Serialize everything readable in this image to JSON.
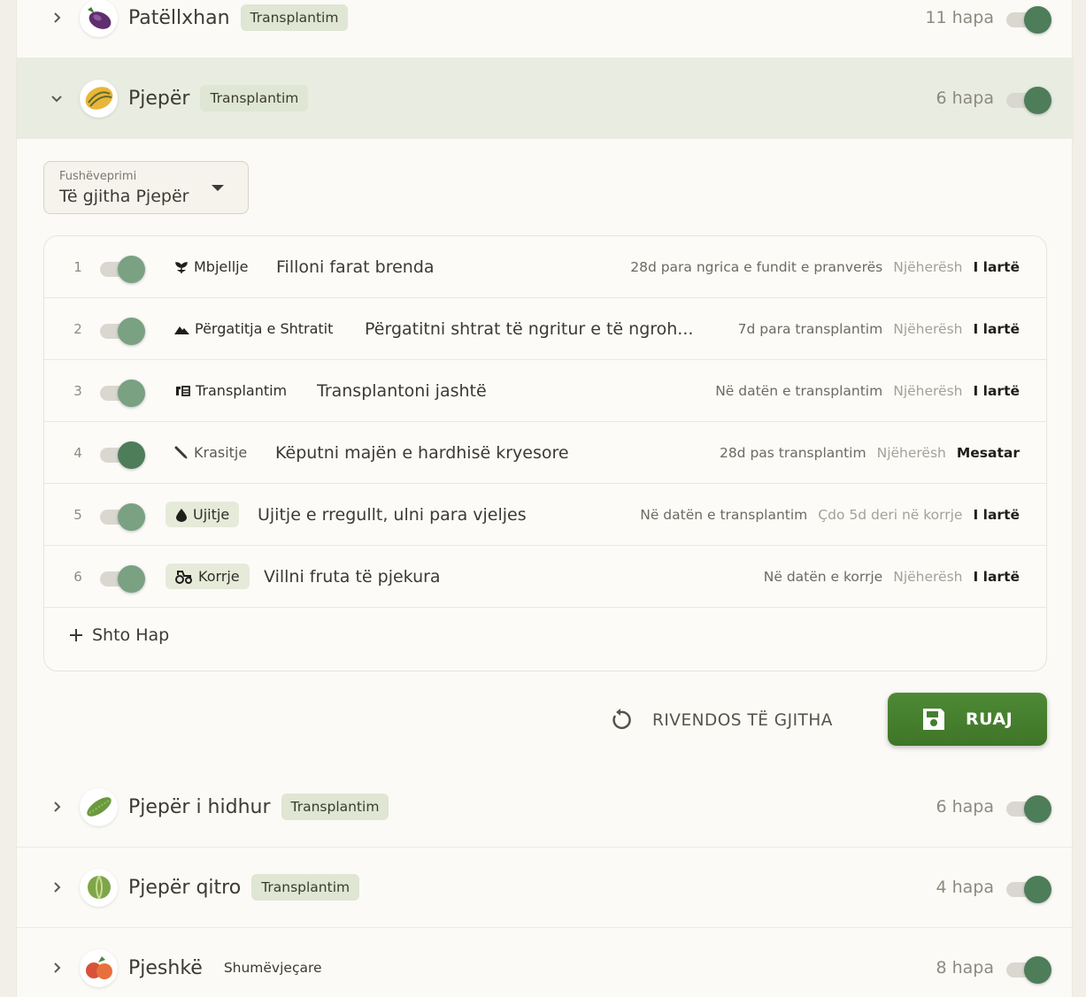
{
  "plants": [
    {
      "name": "Patëllxhan",
      "tag": "Transplantim",
      "steps": "11 hapa"
    },
    {
      "name": "Pjepër",
      "tag": "Transplantim",
      "steps": "6 hapa"
    },
    {
      "name": "Pjepër i hidhur",
      "tag": "Transplantim",
      "steps": "6 hapa"
    },
    {
      "name": "Pjepër qitro",
      "tag": "Transplantim",
      "steps": "4 hapa"
    },
    {
      "name": "Pjeshkë",
      "tag": "Shumëvjeçare",
      "steps": "8 hapa"
    }
  ],
  "scope": {
    "label": "Fushëveprimi",
    "value": "Të gjitha Pjepër"
  },
  "steps": [
    {
      "num": "1",
      "category": "Mbjellje",
      "description": "Filloni farat brenda",
      "timing": "28d para ngrica e fundit e pranverës",
      "repeat": "Njëherësh",
      "priority": "I lartë"
    },
    {
      "num": "2",
      "category": "Përgatitja e Shtratit",
      "description": "Përgatitni shtrat të ngritur e të ngroh...",
      "timing": "7d para transplantim",
      "repeat": "Njëherësh",
      "priority": "I lartë"
    },
    {
      "num": "3",
      "category": "Transplantim",
      "description": "Transplantoni jashtë",
      "timing": "Në datën e transplantim",
      "repeat": "Njëherësh",
      "priority": "I lartë"
    },
    {
      "num": "4",
      "category": "Krasitje",
      "description": "Këputni majën e hardhisë kryesore",
      "timing": "28d pas transplantim",
      "repeat": "Njëherësh",
      "priority": "Mesatar"
    },
    {
      "num": "5",
      "category": "Ujitje",
      "description": "Ujitje e rregullt, ulni para vjeljes",
      "timing": "Në datën e transplantim",
      "repeat": "Çdo 5d deri në korrje",
      "priority": "I lartë"
    },
    {
      "num": "6",
      "category": "Korrje",
      "description": "Villni fruta të pjekura",
      "timing": "Në datën e korrje",
      "repeat": "Njëherësh",
      "priority": "I lartë"
    }
  ],
  "add_step_label": "Shto Hap",
  "actions": {
    "reset_label": "RIVENDOS TË GJITHA",
    "save_label": "RUAJ"
  },
  "colors": {
    "accent": "#4a8331",
    "toggle_on": "#4e7d5a",
    "expanded_row": "#e9ede1",
    "tag_bg": "#dfe6d3"
  },
  "icons": [
    "eggplant",
    "melon",
    "bitter-melon",
    "citron-melon",
    "peach",
    "sprout",
    "mountain",
    "transplant",
    "pruning",
    "water-drop",
    "tractor",
    "reset",
    "save"
  ]
}
